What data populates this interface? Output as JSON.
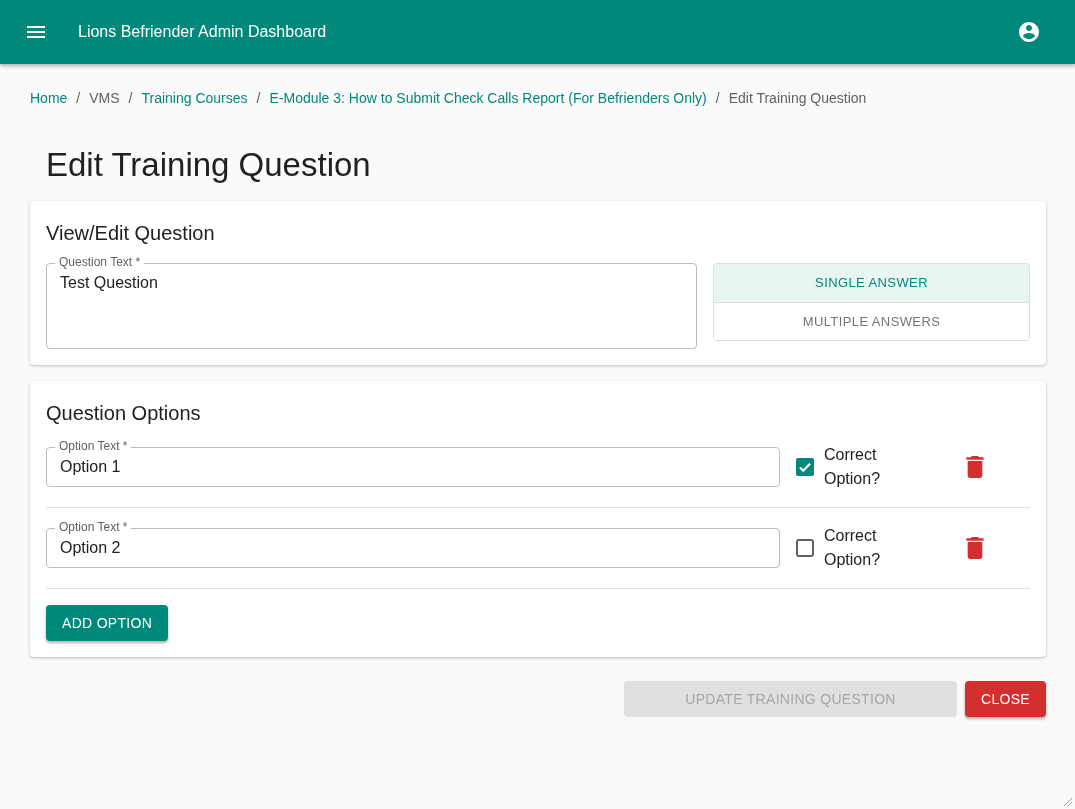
{
  "app_bar": {
    "title": "Lions Befriender Admin Dashboard"
  },
  "breadcrumbs": [
    {
      "kind": "link",
      "label": "Home"
    },
    {
      "kind": "separator",
      "label": "/"
    },
    {
      "kind": "text",
      "label": "VMS"
    },
    {
      "kind": "separator",
      "label": "/"
    },
    {
      "kind": "link",
      "label": "Training Courses"
    },
    {
      "kind": "separator",
      "label": "/"
    },
    {
      "kind": "link",
      "label": "E-Module 3: How to Submit Check Calls Report (For Befrienders Only)"
    },
    {
      "kind": "separator",
      "label": "/"
    },
    {
      "kind": "text",
      "label": "Edit Training Question"
    }
  ],
  "page_title": "Edit Training Question",
  "question_card": {
    "heading": "View/Edit Question",
    "field_label": "Question Text *",
    "value": "Test Question",
    "answer_types": [
      {
        "label": "SINGLE ANSWER",
        "selected": true
      },
      {
        "label": "MULTIPLE ANSWERS",
        "selected": false
      }
    ]
  },
  "options_card": {
    "heading": "Question Options",
    "options": [
      {
        "field_label": "Option Text *",
        "value": "Option 1",
        "correct": true,
        "correct_label": "Correct Option?"
      },
      {
        "field_label": "Option Text *",
        "value": "Option 2",
        "correct": false,
        "correct_label": "Correct Option?"
      }
    ],
    "add_button": "ADD OPTION"
  },
  "actions": [
    {
      "kind": "primary",
      "label": "UPDATE TRAINING QUESTION",
      "disabled": true
    },
    {
      "kind": "danger",
      "label": "CLOSE",
      "disabled": false
    }
  ]
}
